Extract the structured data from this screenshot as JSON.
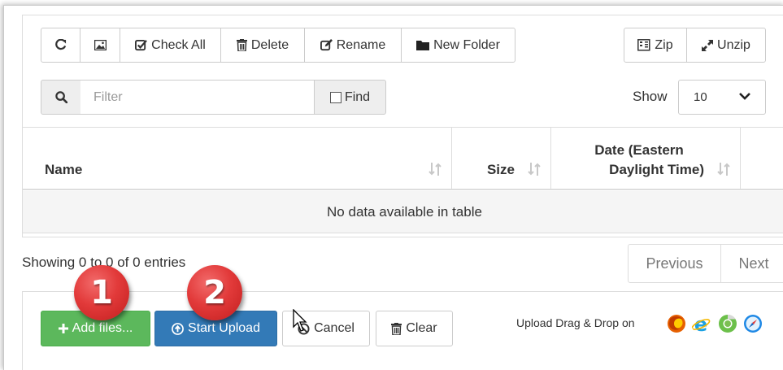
{
  "toolbar": {
    "refresh_icon": "refresh-icon",
    "image_icon": "image-icon",
    "check_all": "Check All",
    "delete": "Delete",
    "rename": "Rename",
    "new_folder": "New Folder",
    "zip": "Zip",
    "unzip": "Unzip"
  },
  "filter": {
    "placeholder": "Filter",
    "find_label": "Find",
    "find_checked": false
  },
  "show": {
    "label": "Show",
    "selected": "10"
  },
  "table": {
    "columns": [
      {
        "label": "Name"
      },
      {
        "label": "Size"
      },
      {
        "label_line1": "Date (Eastern",
        "label_line2": "Daylight Time)"
      }
    ],
    "empty_message": "No data available in table"
  },
  "pagination": {
    "info": "Showing 0 to 0 of 0 entries",
    "previous": "Previous",
    "next": "Next"
  },
  "upload": {
    "add_files": "Add files...",
    "start_upload": "Start Upload",
    "cancel": "Cancel",
    "clear": "Clear",
    "drag_drop_label": "Upload Drag & Drop on"
  },
  "callouts": {
    "step1": "1",
    "step2": "2"
  },
  "colors": {
    "success": "#5cb85c",
    "primary": "#337ab7",
    "badge_red": "#e23a3a",
    "border": "#dddddd"
  }
}
